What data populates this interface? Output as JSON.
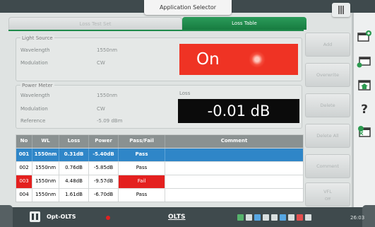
{
  "app_selector": {
    "label": "Application Selector"
  },
  "tabs": {
    "loss_test_set": "Loss Test Set",
    "loss_table": "Loss Table"
  },
  "light_source": {
    "title": "Light Source",
    "wavelength_label": "Wavelength",
    "wavelength_value": "1550nm",
    "modulation_label": "Modulation",
    "modulation_value": "CW",
    "state": "On"
  },
  "power_meter": {
    "title": "Power Meter",
    "wavelength_label": "Wavelength",
    "wavelength_value": "1550nm",
    "modulation_label": "Modulation",
    "modulation_value": "CW",
    "reference_label": "Reference",
    "reference_value": "-5.09 dBm",
    "loss_label": "Loss",
    "loss_value": "-0.01 dB"
  },
  "table": {
    "headers": {
      "no": "No",
      "wl": "WL",
      "loss": "Loss",
      "power": "Power",
      "passfail": "Pass/Fail",
      "comment": "Comment"
    },
    "rows": [
      {
        "no": "001",
        "wl": "1550nm",
        "loss": "0.31dB",
        "power": "-5.40dB",
        "passfail": "Pass",
        "comment": ""
      },
      {
        "no": "002",
        "wl": "1550nm",
        "loss": "0.76dB",
        "power": "-5.85dB",
        "passfail": "Pass",
        "comment": ""
      },
      {
        "no": "003",
        "wl": "1550nm",
        "loss": "4.48dB",
        "power": "-9.57dB",
        "passfail": "Fail",
        "comment": ""
      },
      {
        "no": "004",
        "wl": "1550nm",
        "loss": "1.61dB",
        "power": "-6.70dB",
        "passfail": "Pass",
        "comment": ""
      }
    ]
  },
  "buttons": {
    "add": "Add",
    "overwrite": "Overwrite",
    "delete": "Delete",
    "delete_all": "Delete All",
    "comment": "Comment",
    "vfl": "VFL",
    "vfl_state": "Off"
  },
  "bottom_bar": {
    "app_name": "Opt-OLTS",
    "mode": "OLTS",
    "time": "26:03"
  },
  "colors": {
    "accent_green": "#177c40",
    "selected_row": "#2f86c8",
    "fail_red": "#e4201f",
    "on_red": "#ef3324"
  },
  "sidebar_icons": [
    "add-file-icon",
    "export-file-icon",
    "home-icon",
    "help-icon",
    "settings-file-icon"
  ]
}
